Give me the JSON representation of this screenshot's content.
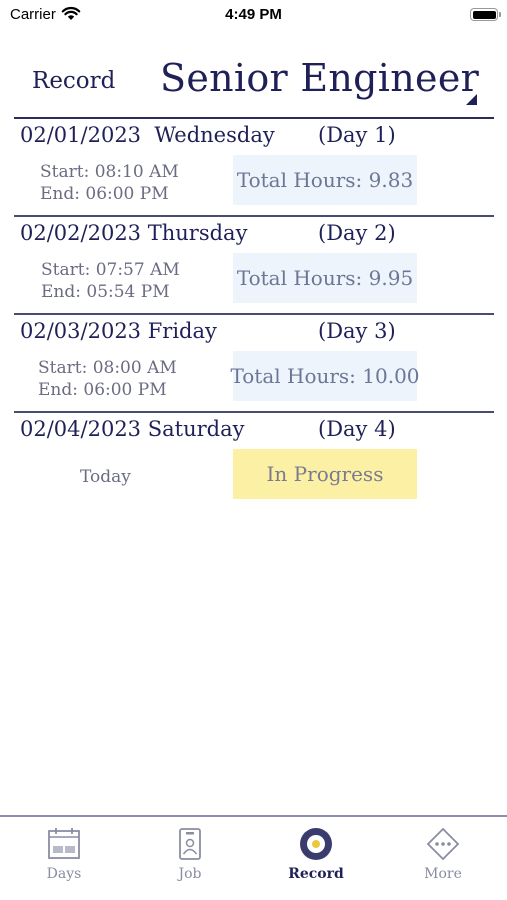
{
  "status_bar": {
    "carrier": "Carrier",
    "time": "4:49 PM"
  },
  "header": {
    "section": "Record",
    "job_title": "Senior Engineer"
  },
  "days": [
    {
      "date": "02/01/2023",
      "weekday": "Wednesday",
      "day_label": "(Day 1)",
      "start": "Start: 08:10 AM",
      "end": "End: 06:00 PM",
      "hours": "Total Hours: 9.83"
    },
    {
      "date": "02/02/2023",
      "weekday": "Thursday",
      "day_label": "(Day 2)",
      "start": "Start: 07:57 AM",
      "end": "End: 05:54 PM",
      "hours": "Total Hours: 9.95"
    },
    {
      "date": "02/03/2023",
      "weekday": "Friday",
      "day_label": "(Day 3)",
      "start": "Start: 08:00 AM",
      "end": "End: 06:00 PM",
      "hours": "Total Hours: 10.00"
    },
    {
      "date": "02/04/2023",
      "weekday": "Saturday",
      "day_label": "(Day 4)",
      "today": "Today",
      "status": "In Progress"
    }
  ],
  "tabs": [
    {
      "label": "Days",
      "icon": "calendar-icon",
      "active": false
    },
    {
      "label": "Job",
      "icon": "id-badge-icon",
      "active": false
    },
    {
      "label": "Record",
      "icon": "record-icon",
      "active": true
    },
    {
      "label": "More",
      "icon": "more-icon",
      "active": false
    }
  ],
  "colors": {
    "accent": "#1f2057",
    "hours_box": "#eef4fb",
    "in_progress_box": "#fbf0a4"
  }
}
